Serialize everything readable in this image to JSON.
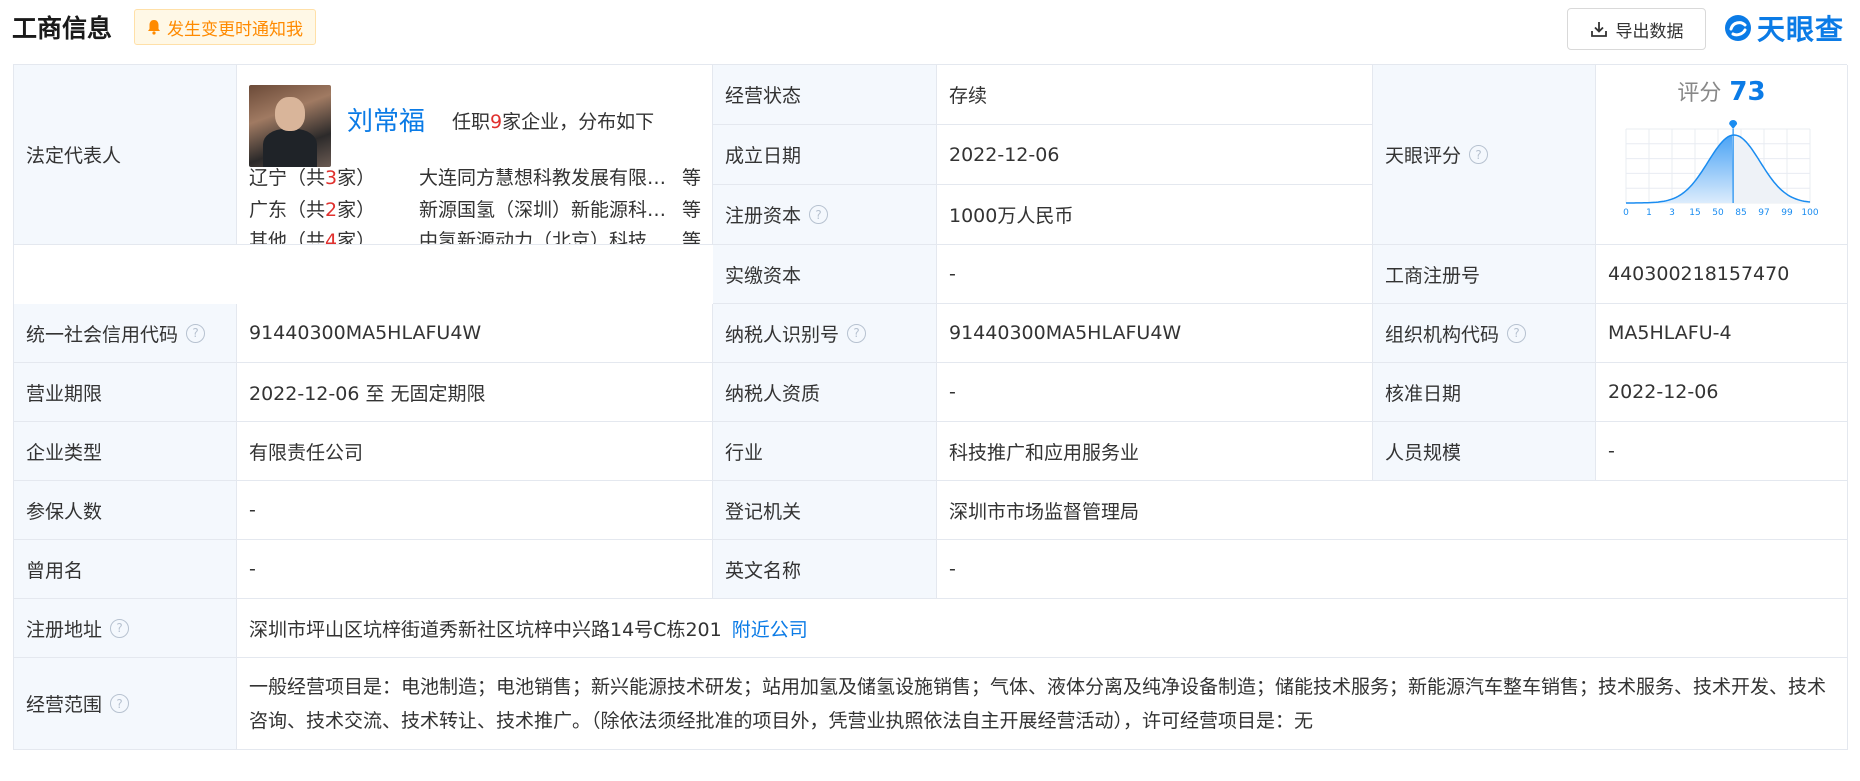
{
  "header": {
    "title": "工商信息",
    "notify_label": "发生变更时通知我",
    "export_label": "导出数据",
    "logo_text": "天眼查"
  },
  "legal_rep": {
    "label": "法定代表人",
    "name": "刘常福",
    "tenure_prefix": "任职",
    "tenure_count": "9",
    "tenure_suffix": "家企业，分布如下",
    "distribution": [
      {
        "region_prefix": "辽宁（共",
        "count": "3",
        "region_suffix": "家）",
        "company": "大连同方慧想科教发展有限公司",
        "etc": "等"
      },
      {
        "region_prefix": "广东（共",
        "count": "2",
        "region_suffix": "家）",
        "company": "新源国氢（深圳）新能源科技有限公司",
        "etc": "等"
      },
      {
        "region_prefix": "其他（共",
        "count": "4",
        "region_suffix": "家）",
        "company": "中氢新源动力（北京）科技有限公司",
        "etc": "等"
      }
    ]
  },
  "fields": {
    "status_label": "经营状态",
    "status_value": "存续",
    "founded_label": "成立日期",
    "founded_value": "2022-12-06",
    "capital_label": "注册资本",
    "capital_value": "1000万人民币",
    "paid_label": "实缴资本",
    "paid_value": "-",
    "score_label": "天眼评分",
    "reg_no_label": "工商注册号",
    "reg_no_value": "440300218157470",
    "credit_label": "统一社会信用代码",
    "credit_value": "91440300MA5HLAFU4W",
    "taxid_label": "纳税人识别号",
    "taxid_value": "91440300MA5HLAFU4W",
    "org_label": "组织机构代码",
    "org_value": "MA5HLAFU-4",
    "term_label": "营业期限",
    "term_value": "2022-12-06 至 无固定期限",
    "taxq_label": "纳税人资质",
    "taxq_value": "-",
    "approve_label": "核准日期",
    "approve_value": "2022-12-06",
    "type_label": "企业类型",
    "type_value": "有限责任公司",
    "industry_label": "行业",
    "industry_value": "科技推广和应用服务业",
    "staff_label": "人员规模",
    "staff_value": "-",
    "insured_label": "参保人数",
    "insured_value": "-",
    "authority_label": "登记机关",
    "authority_value": "深圳市市场监督管理局",
    "former_label": "曾用名",
    "former_value": "-",
    "english_label": "英文名称",
    "english_value": "-",
    "address_label": "注册地址",
    "address_value": "深圳市坪山区坑梓街道秀新社区坑梓中兴路14号C栋201",
    "nearby_label": "附近公司",
    "scope_label": "经营范围",
    "scope_value": "一般经营项目是：电池制造；电池销售；新兴能源技术研发；站用加氢及储氢设施销售；气体、液体分离及纯净设备制造；储能技术服务；新能源汽车整车销售；技术服务、技术开发、技术咨询、技术交流、技术转让、技术推广。（除依法须经批准的项目外，凭营业执照依法自主开展经营活动），许可经营项目是：无"
  },
  "score": {
    "label": "评分",
    "value": 73,
    "axis": [
      "0",
      "1",
      "3",
      "15",
      "50",
      "85",
      "97",
      "99",
      "100"
    ],
    "colors": {
      "curve": "#1a8cf0",
      "pin": "#1a8cf0",
      "grid": "#e8ecf2"
    }
  },
  "colors": {
    "accent": "#0b7be6",
    "highlight": "#e0312e",
    "label_bg": "#f4f8fd",
    "notify": "#ff8a00"
  }
}
